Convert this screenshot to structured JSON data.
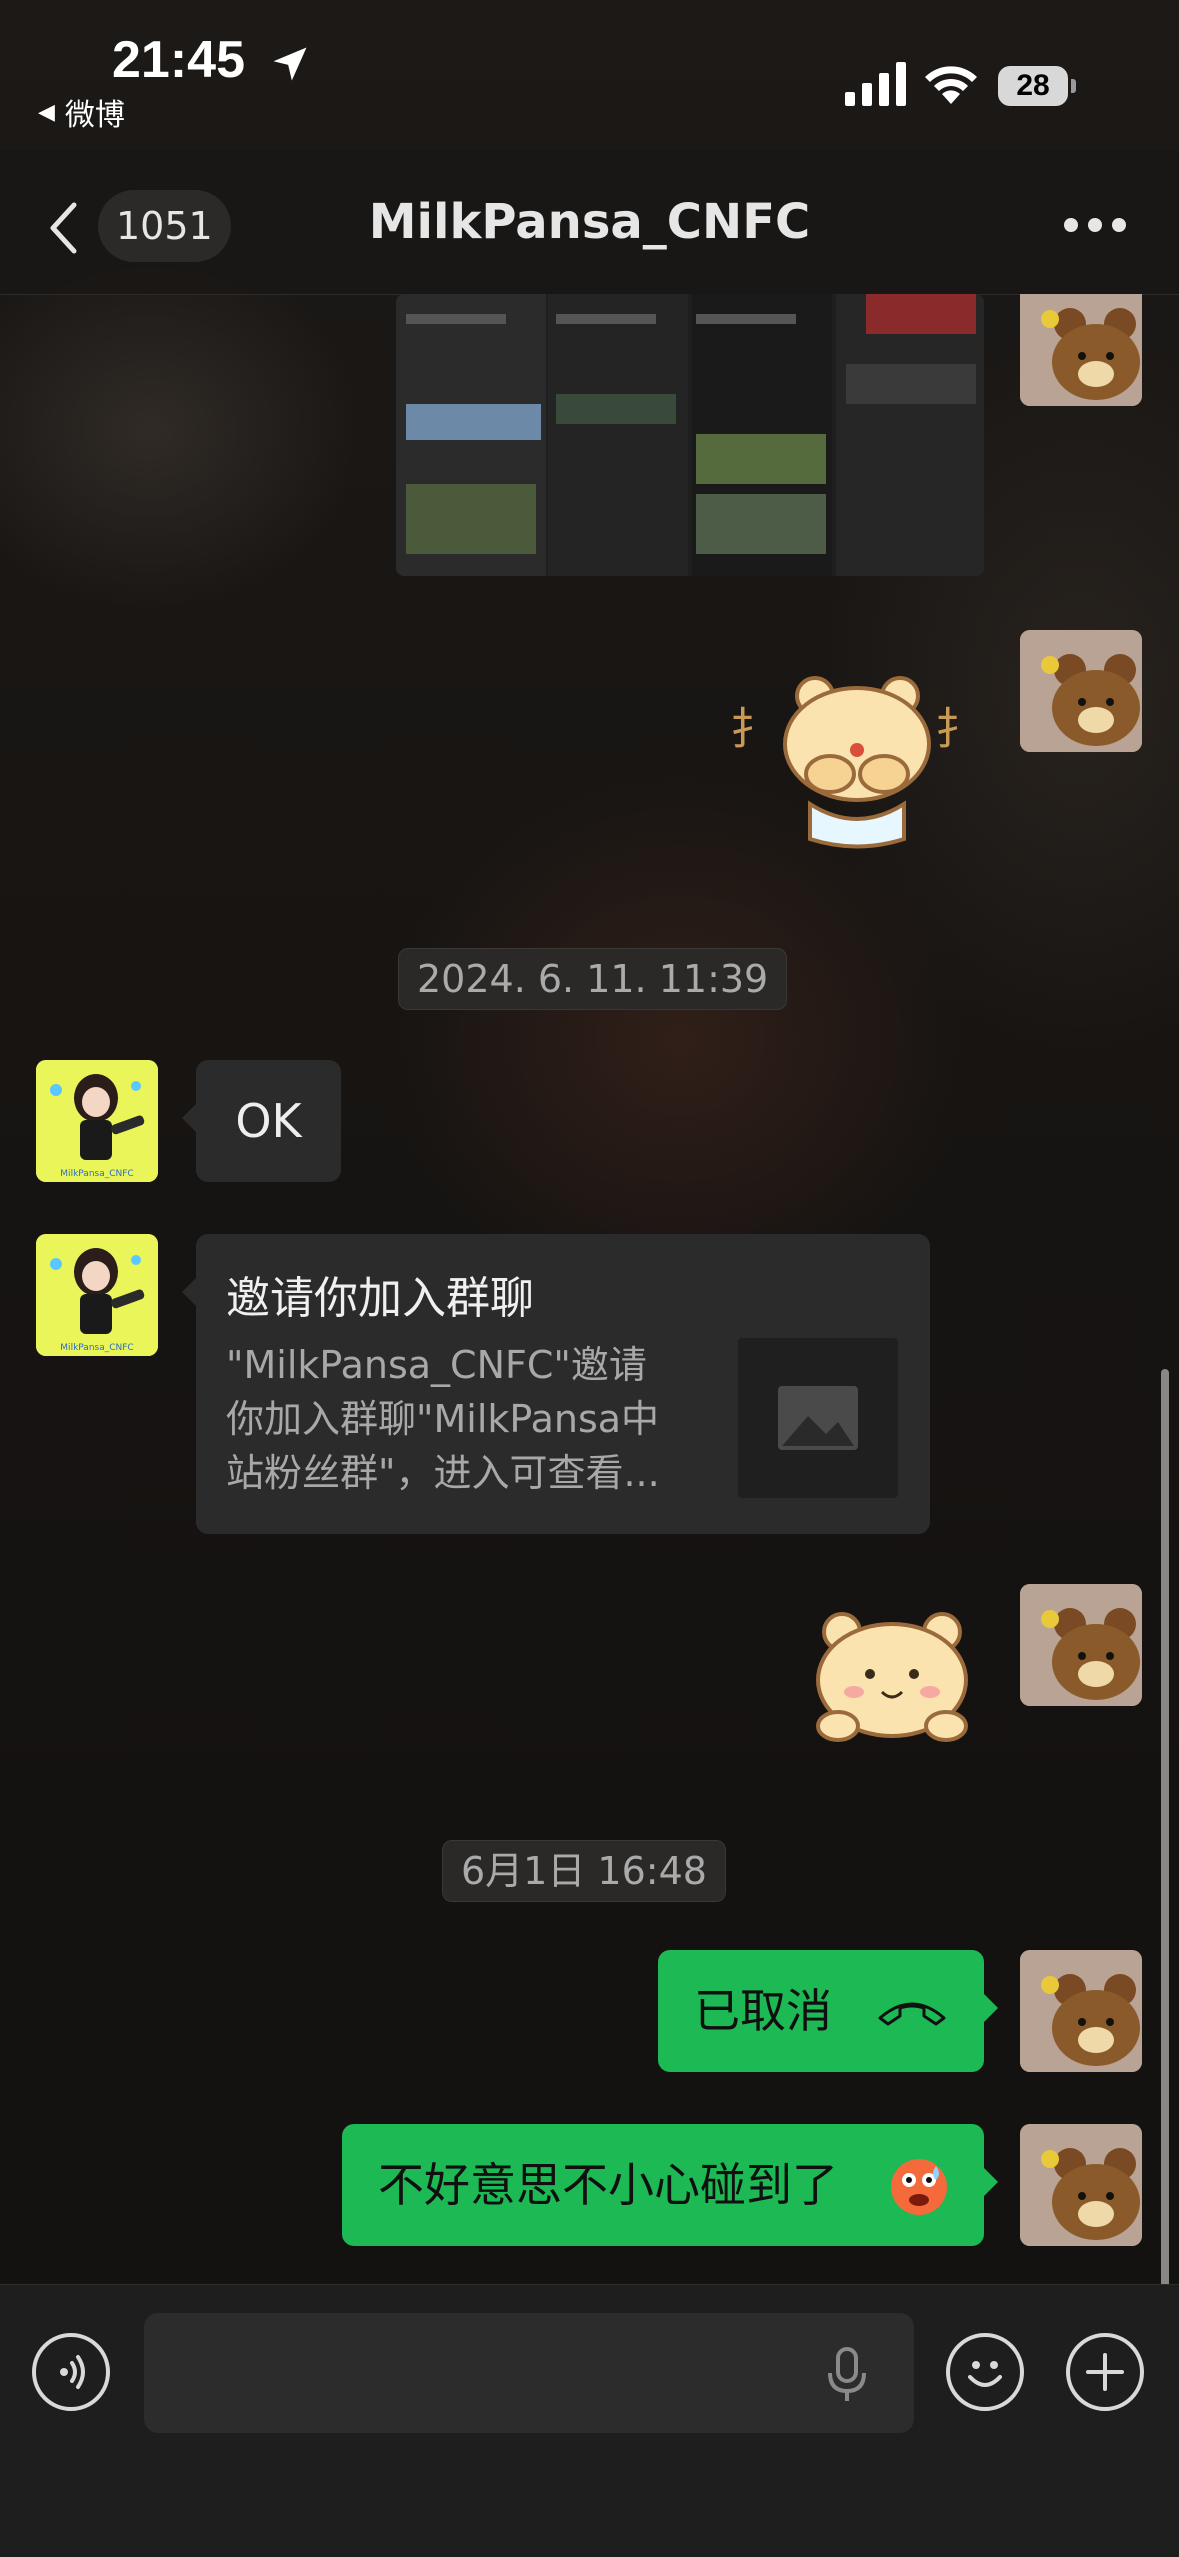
{
  "status_bar": {
    "time": "21:45",
    "back_app": "微博",
    "battery": "28"
  },
  "nav": {
    "unread_count": "1051",
    "title": "MilkPansa_CNFC"
  },
  "messages": {
    "timestamp_1": "2024. 6. 11. 11:39",
    "ok_text": "OK",
    "invite_card": {
      "title": "邀请你加入群聊",
      "line1": "\"MilkPansa_CNFC\"邀请",
      "line2": "你加入群聊\"MilkPansa中",
      "line3": "站粉丝群\"，进入可查看..."
    },
    "timestamp_2": "6月1日 16:48",
    "call_cancelled": "已取消",
    "apology": "不好意思不小心碰到了"
  },
  "input_bar": {
    "placeholder": ""
  },
  "colors": {
    "sent_bubble": "#1db954",
    "received_bubble": "#2b2b2b",
    "background": "#151311"
  }
}
